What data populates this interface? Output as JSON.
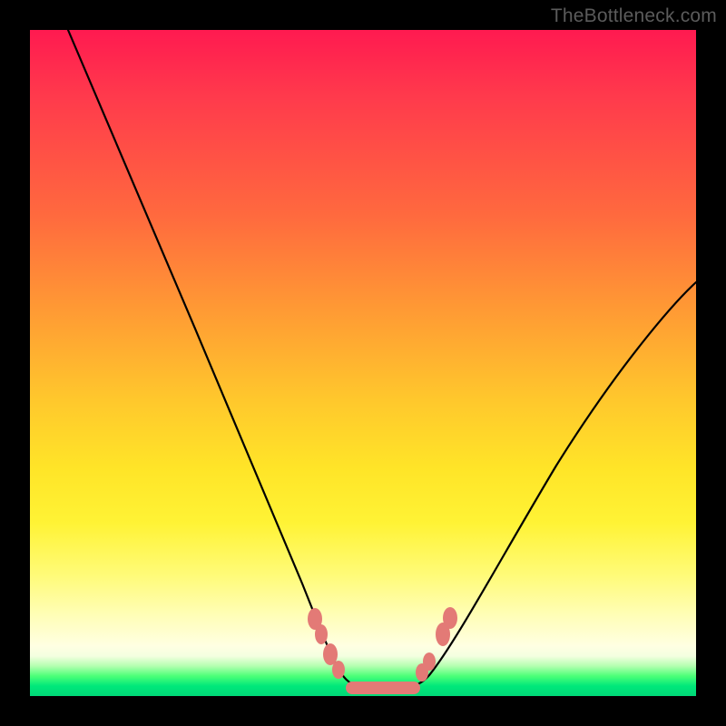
{
  "watermark": "TheBottleneck.com",
  "colors": {
    "frame": "#000000",
    "curve": "#000000",
    "marker": "#e37a76",
    "gradient_top": "#ff1a50",
    "gradient_bottom_green": "#00d878"
  },
  "chart_data": {
    "type": "line",
    "title": "",
    "xlabel": "",
    "ylabel": "",
    "xlim": [
      0,
      100
    ],
    "ylim": [
      0,
      100
    ],
    "x": [
      5,
      10,
      15,
      20,
      25,
      30,
      35,
      38,
      40,
      42,
      44,
      46,
      48,
      50,
      52,
      54,
      56,
      58,
      60,
      62,
      65,
      70,
      75,
      80,
      85,
      90,
      95,
      100
    ],
    "y": [
      100,
      90,
      79,
      67,
      55,
      43,
      31,
      23,
      18,
      13,
      8,
      4.5,
      2,
      1,
      1,
      1,
      1.5,
      3,
      6,
      10,
      16,
      25,
      33,
      40,
      46,
      51,
      56,
      60
    ],
    "annotations": [
      {
        "x": 42.5,
        "y": 11,
        "label": "marker"
      },
      {
        "x": 43.5,
        "y": 8.5,
        "label": "marker"
      },
      {
        "x": 45.0,
        "y": 6,
        "label": "marker"
      },
      {
        "x": 46.0,
        "y": 4,
        "label": "marker"
      },
      {
        "x": 61.0,
        "y": 9,
        "label": "marker"
      },
      {
        "x": 61.8,
        "y": 11,
        "label": "marker"
      },
      {
        "x": 58.5,
        "y": 4.5,
        "label": "marker"
      },
      {
        "x": 57.5,
        "y": 3,
        "label": "marker"
      }
    ],
    "plateau": {
      "x_start": 47,
      "x_end": 57,
      "y": 1.2
    }
  }
}
